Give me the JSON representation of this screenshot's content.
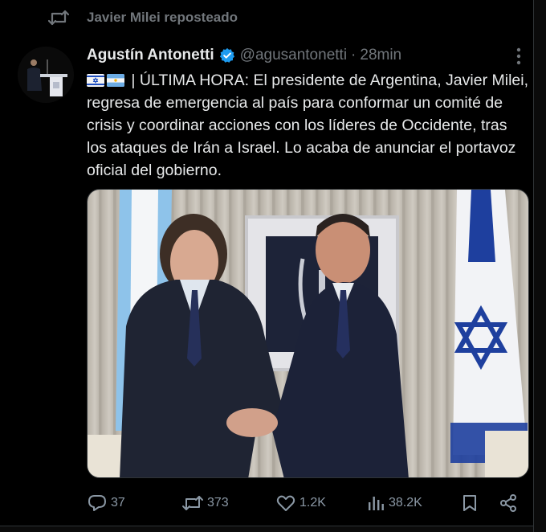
{
  "repost": {
    "text": "Javier Milei reposteado"
  },
  "tweet": {
    "author_name": "Agustín Antonetti",
    "handle": "@agusantonetti",
    "separator": "·",
    "time": "28min",
    "body": "| ÚLTIMA HORA: El presidente de Argentina, Javier Milei, regresa de emergencia al país para conformar un comité de crisis y coordinar acciones con los líderes de Occidente, tras los ataques de Irán a Israel. Lo acaba de anunciar el portavoz oficial del gobierno.",
    "flags": [
      "flag-israel-icon",
      "flag-argentina-icon"
    ]
  },
  "actions": {
    "replies": "37",
    "reposts": "373",
    "likes": "1.2K",
    "views": "38.2K"
  },
  "colors": {
    "text": "#e7e9ea",
    "muted": "#71767b",
    "verified": "#1d9bf0",
    "background": "#000000"
  }
}
